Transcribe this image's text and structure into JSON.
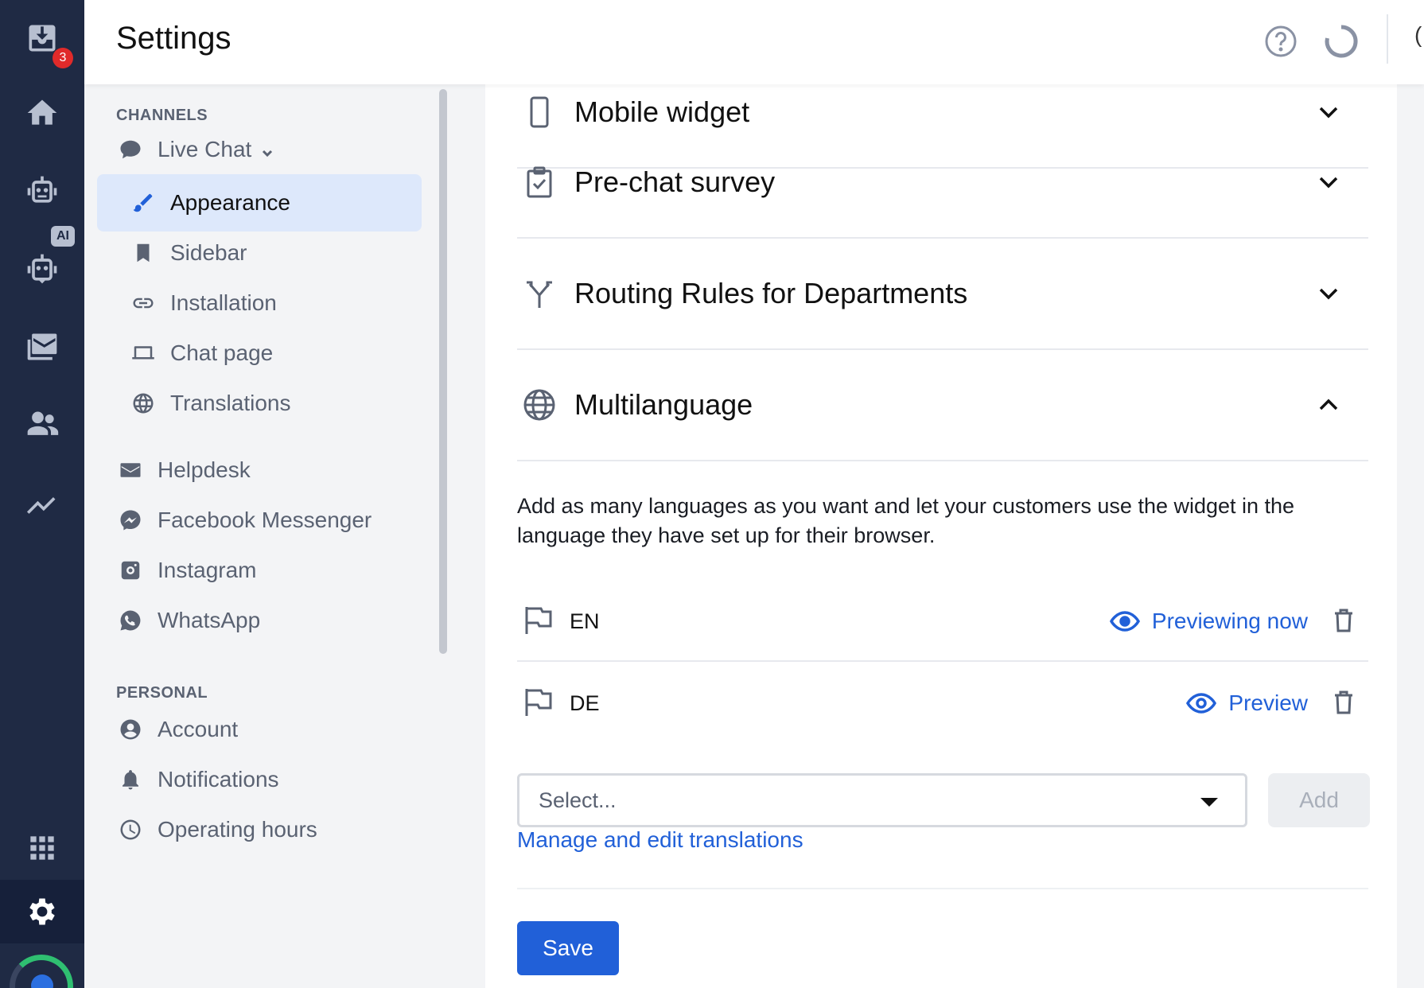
{
  "header": {
    "title": "Settings",
    "cut_text": "("
  },
  "rail": {
    "inbox_badge": "3",
    "ai_tag": "AI",
    "items": [
      "inbox-icon",
      "home-icon",
      "ai-bot-icon",
      "chatbot-icon",
      "mail-icon",
      "contacts-icon",
      "analytics-icon",
      "apps-grid-icon",
      "settings-icon",
      "progress-icon"
    ]
  },
  "nav": {
    "channels_heading": "CHANNELS",
    "live_chat": "Live Chat",
    "appearance": "Appearance",
    "sidebar": "Sidebar",
    "installation": "Installation",
    "chat_page": "Chat page",
    "translations": "Translations",
    "helpdesk": "Helpdesk",
    "facebook": "Facebook Messenger",
    "instagram": "Instagram",
    "whatsapp": "WhatsApp",
    "personal_heading": "PERSONAL",
    "account": "Account",
    "notifications": "Notifications",
    "operating_hours": "Operating hours"
  },
  "main": {
    "mobile_widget": "Mobile widget",
    "prechat": "Pre-chat survey",
    "routing": "Routing Rules for Departments",
    "multilanguage": "Multilanguage",
    "description": "Add as many languages as you want and let your customers use the widget in the language they have set up for their browser.",
    "languages": [
      {
        "code": "EN",
        "action": "Previewing now"
      },
      {
        "code": "DE",
        "action": "Preview"
      }
    ],
    "select_placeholder": "Select...",
    "add_label": "Add",
    "manage_link": "Manage and edit translations",
    "save_label": "Save"
  },
  "colors": {
    "accent": "#2160d8",
    "rail_bg": "#1f2a44",
    "active_nav_bg": "#dde8fb",
    "badge": "#e02a2a"
  }
}
